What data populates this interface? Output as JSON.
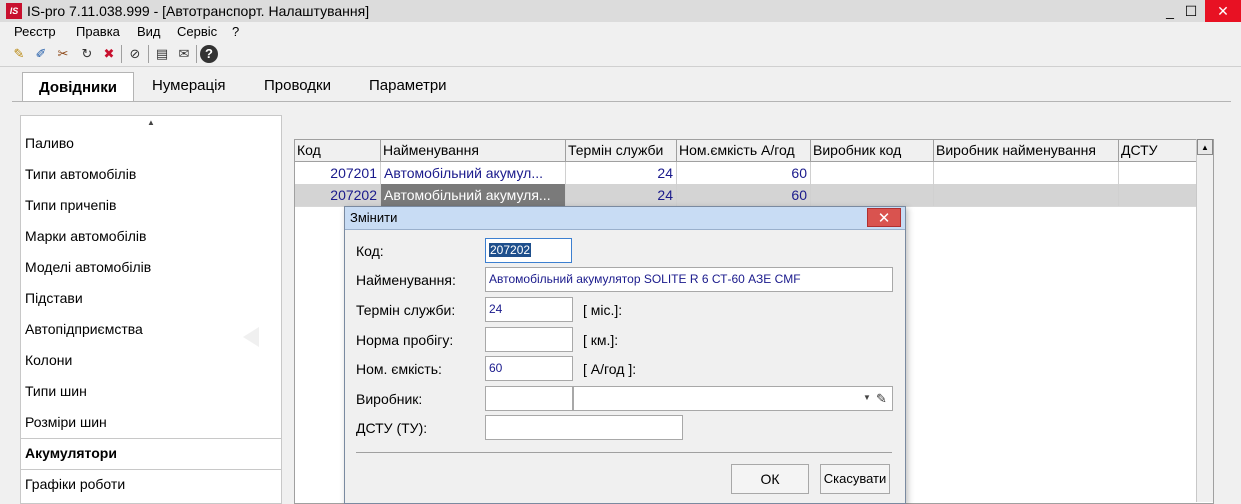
{
  "window": {
    "title": "IS-pro 7.11.038.999 - [Автотранспорт. Налаштування]",
    "logo": "IS",
    "min": "_",
    "max": "☐",
    "close": "✕"
  },
  "menu": [
    "Реєстр",
    "Правка",
    "Вид",
    "Сервіс",
    "?"
  ],
  "toolbar_icons": [
    "new-icon",
    "edit-icon",
    "delete-icon",
    "refresh-icon",
    "cancel-icon",
    "filter-icon",
    "print-icon",
    "mail-icon",
    "help-icon"
  ],
  "toolbar_glyphs": [
    "✎",
    "✐",
    "✂",
    "↻",
    "✖",
    "⊘",
    "▤",
    "✉",
    "?"
  ],
  "tabs": [
    "Довідники",
    "Нумерація",
    "Проводки",
    "Параметри"
  ],
  "left_items": [
    "Паливо",
    "Типи автомобілів",
    "Типи причепів",
    "Марки автомобілів",
    "Моделі автомобілів",
    "Підстави",
    "Автопідприємства",
    "Колони",
    "Типи шин",
    "Розміри шин",
    "Акумулятори",
    "Графіки роботи"
  ],
  "left_active": "Акумулятори",
  "grid": {
    "columns": [
      "Код",
      "Найменування",
      "Термін служби",
      "Ном.ємкість А/год",
      "Виробник код",
      "Виробник найменування",
      "ДСТУ"
    ],
    "rows": [
      [
        "207201",
        "Автомобільний акумул...",
        "24",
        "60",
        "",
        "",
        ""
      ],
      [
        "207202",
        "Автомобільний акумуля...",
        "24",
        "60",
        "",
        "",
        ""
      ]
    ]
  },
  "dialog": {
    "title": "Змінити",
    "close": "✕",
    "labels": {
      "code": "Код:",
      "name": "Найменування:",
      "service": "Термін служби:",
      "mileage": "Норма пробігу:",
      "capacity": "Ном. ємкість:",
      "maker": "Виробник:",
      "dstu": "ДСТУ (ТУ):"
    },
    "values": {
      "code": "207202",
      "name": "Автомобільний акумулятор SOLITE R 6 СТ-60 АЗЕ CMF",
      "service": "24",
      "mileage": "",
      "capacity": "60",
      "maker_code": "",
      "maker_name": "",
      "dstu": ""
    },
    "units": {
      "service": "[ міс.]:",
      "mileage": "[ км.]:",
      "capacity": "[ А/год ]:"
    },
    "ok": "ОК",
    "cancel": "Скасувати"
  }
}
